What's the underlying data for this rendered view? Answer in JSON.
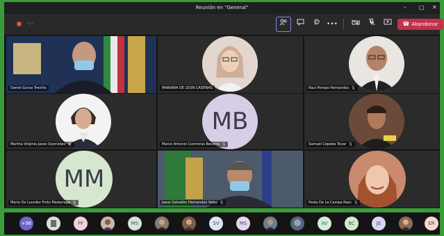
{
  "window": {
    "title": "Reunión en \"General\"",
    "min": "–",
    "max": "□",
    "close": "✕"
  },
  "toolbar": {
    "timer": "-:-",
    "leave_label": "Abandonar",
    "leave_icon": "phone-icon",
    "accent": "#c4314b"
  },
  "tiles": [
    {
      "name": "Daniel Garza Treviño",
      "type": "video",
      "bg": "#2d4168"
    },
    {
      "name": "MARIANA DE LEON CADENAS",
      "type": "photo",
      "bg": "#2a2a2a",
      "photo": "#caa58e"
    },
    {
      "name": "Raul Pompa Hernandez",
      "type": "photo",
      "bg": "#2a2a2a",
      "photo": "#d9d4cf"
    },
    {
      "name": "Martha Virginia Jasso Oyervides",
      "type": "photo",
      "bg": "#2a2a2a",
      "photo": "#c9a7a0"
    },
    {
      "name": "Marco Antonio Contreras Becerra",
      "type": "initials",
      "initials": "MB",
      "bg": "#2a2a2a",
      "color": "#d8cde6"
    },
    {
      "name": "Samuel Cepeda Tovar",
      "type": "photo",
      "bg": "#2a2a2a",
      "photo": "#a56e4e"
    },
    {
      "name": "Maria De Lourdes Froto Madariaga",
      "type": "initials",
      "initials": "MM",
      "bg": "#2a2a2a",
      "color": "#d6e7d0"
    },
    {
      "name": "Jesus Salvador Hernandez Velez",
      "type": "video",
      "bg": "#5e6c80"
    },
    {
      "name": "Paola De La Campa Rasc",
      "type": "photo",
      "bg": "#2a2a2a",
      "photo": "#e0b19a"
    }
  ],
  "participants_strip": [
    {
      "label": "+96",
      "color": "#6b69c8",
      "text": "#ffffff"
    },
    {
      "label": "",
      "color": "#dcdcdc",
      "text": "#333"
    },
    {
      "label": "PF",
      "color": "#f3d0de",
      "text": "#7a3b52"
    },
    {
      "label": "",
      "color": "#cbb6a8",
      "text": "#333"
    },
    {
      "label": "MS",
      "color": "#d6e4d7",
      "text": "#3b5b3f"
    },
    {
      "label": "",
      "color": "#8a7b6d",
      "text": "#333"
    },
    {
      "label": "",
      "color": "#7a5c4c",
      "text": "#333"
    },
    {
      "label": "SV",
      "color": "#dbe5f3",
      "text": "#3b4f6e"
    },
    {
      "label": "MS",
      "color": "#e4d6ec",
      "text": "#5b3b6e"
    },
    {
      "label": "",
      "color": "#6d7c8e",
      "text": "#333"
    },
    {
      "label": "",
      "color": "#556577",
      "text": "#333"
    },
    {
      "label": "AV",
      "color": "#d6ecd9",
      "text": "#3b6e47"
    },
    {
      "label": "BC",
      "color": "#d4e8d0",
      "text": "#3f6b39"
    },
    {
      "label": "JE",
      "color": "#dad6f0",
      "text": "#4a4370"
    },
    {
      "label": "",
      "color": "#8a6a52",
      "text": "#333"
    },
    {
      "label": "ER",
      "color": "#f5d6d0",
      "text": "#7a3b2e"
    }
  ],
  "mic_icon": "mic-icon"
}
